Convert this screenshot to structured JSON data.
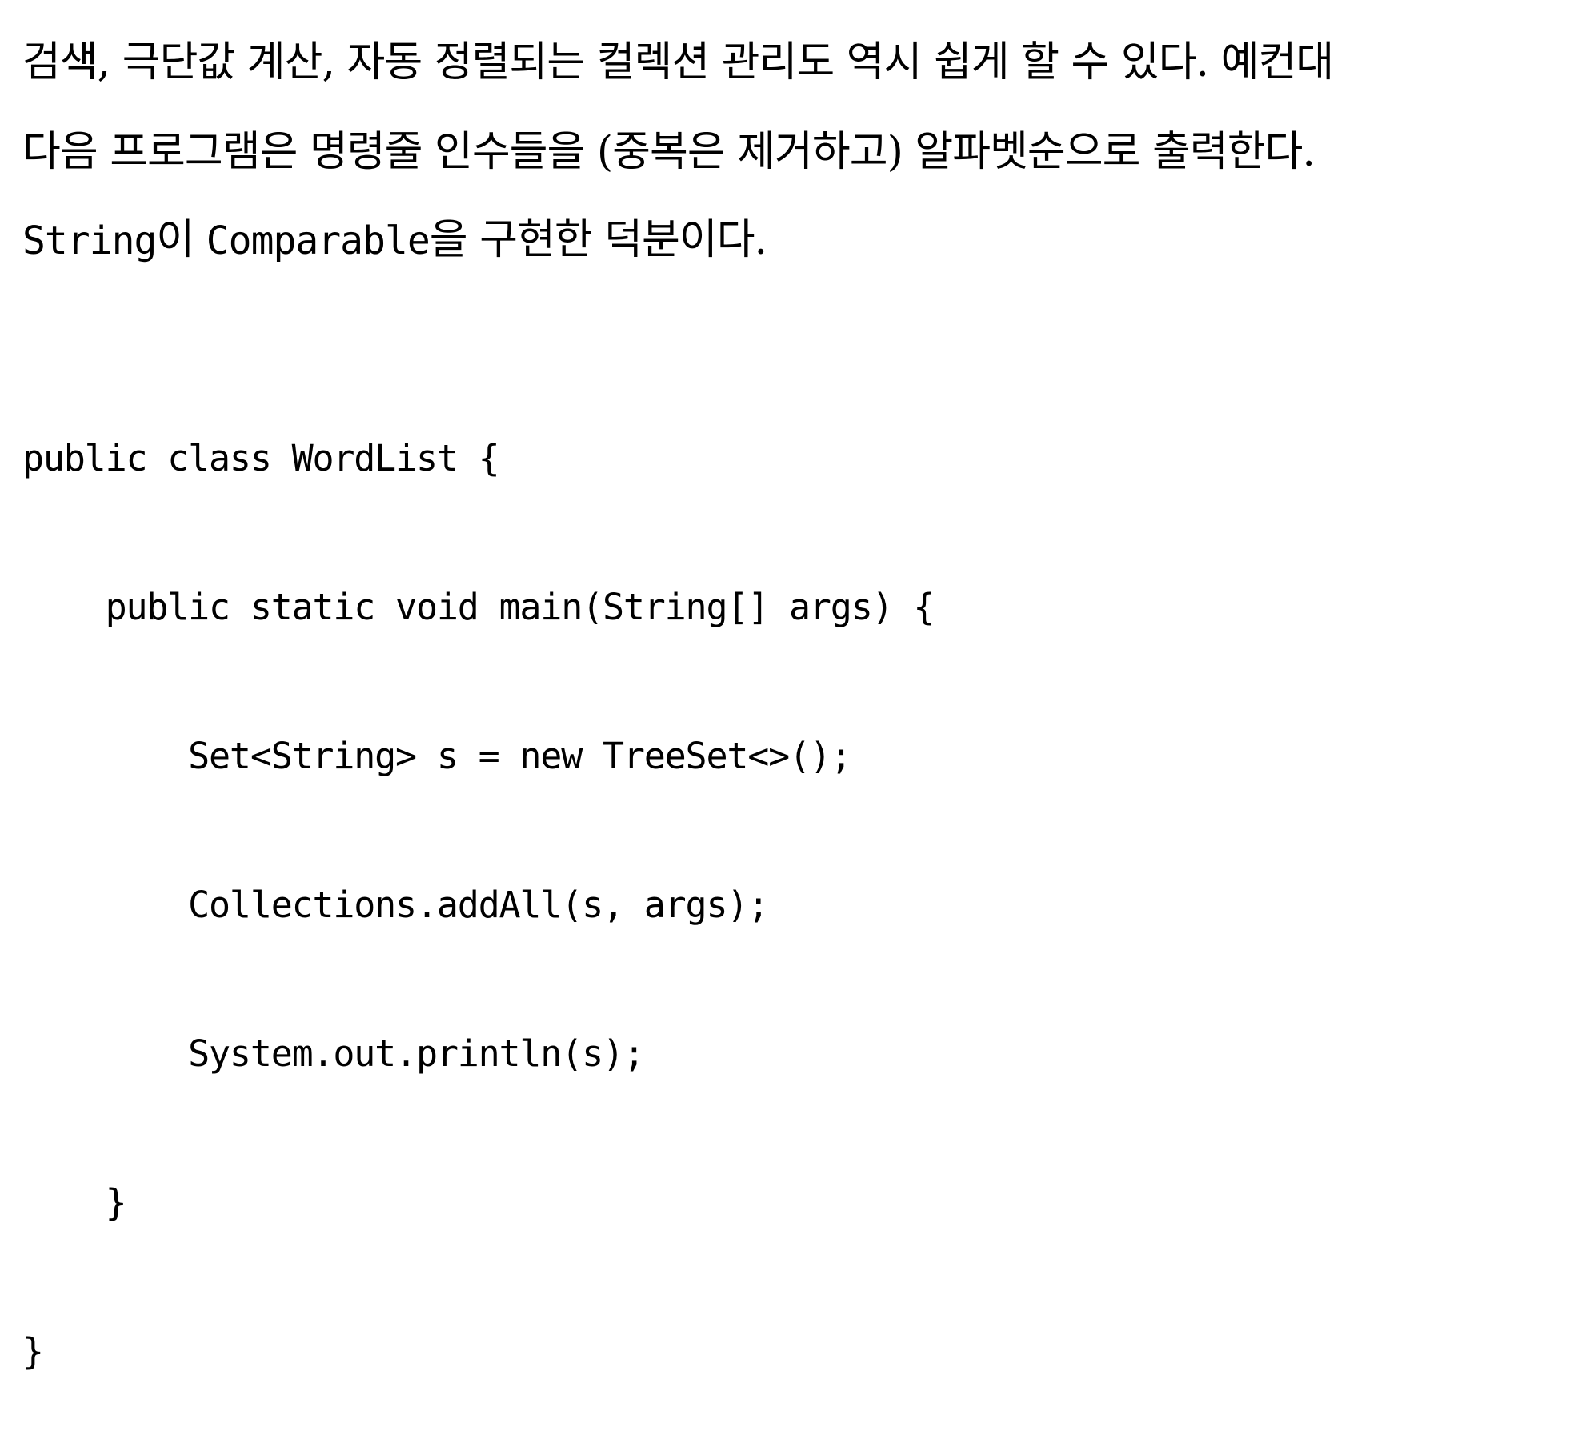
{
  "paragraph": {
    "line1": "검색, 극단값 계산, 자동 정렬되는 컬렉션 관리도 역시 쉽게 할 수 있다. 예컨대",
    "line2": "다음 프로그램은 명령줄 인수들을 (중복은 제거하고) 알파벳순으로 출력한다.",
    "line3_code": "String",
    "line3_mid": "이 ",
    "line3_code2": "Comparable",
    "line3_end": "을 구현한 덕분이다."
  },
  "code": {
    "lines": [
      "public class WordList {",
      "    public static void main(String[] args) {",
      "        Set<String> s = new TreeSet<>();",
      "        Collections.addAll(s, args);",
      "        System.out.println(s);",
      "    }",
      "}"
    ]
  }
}
